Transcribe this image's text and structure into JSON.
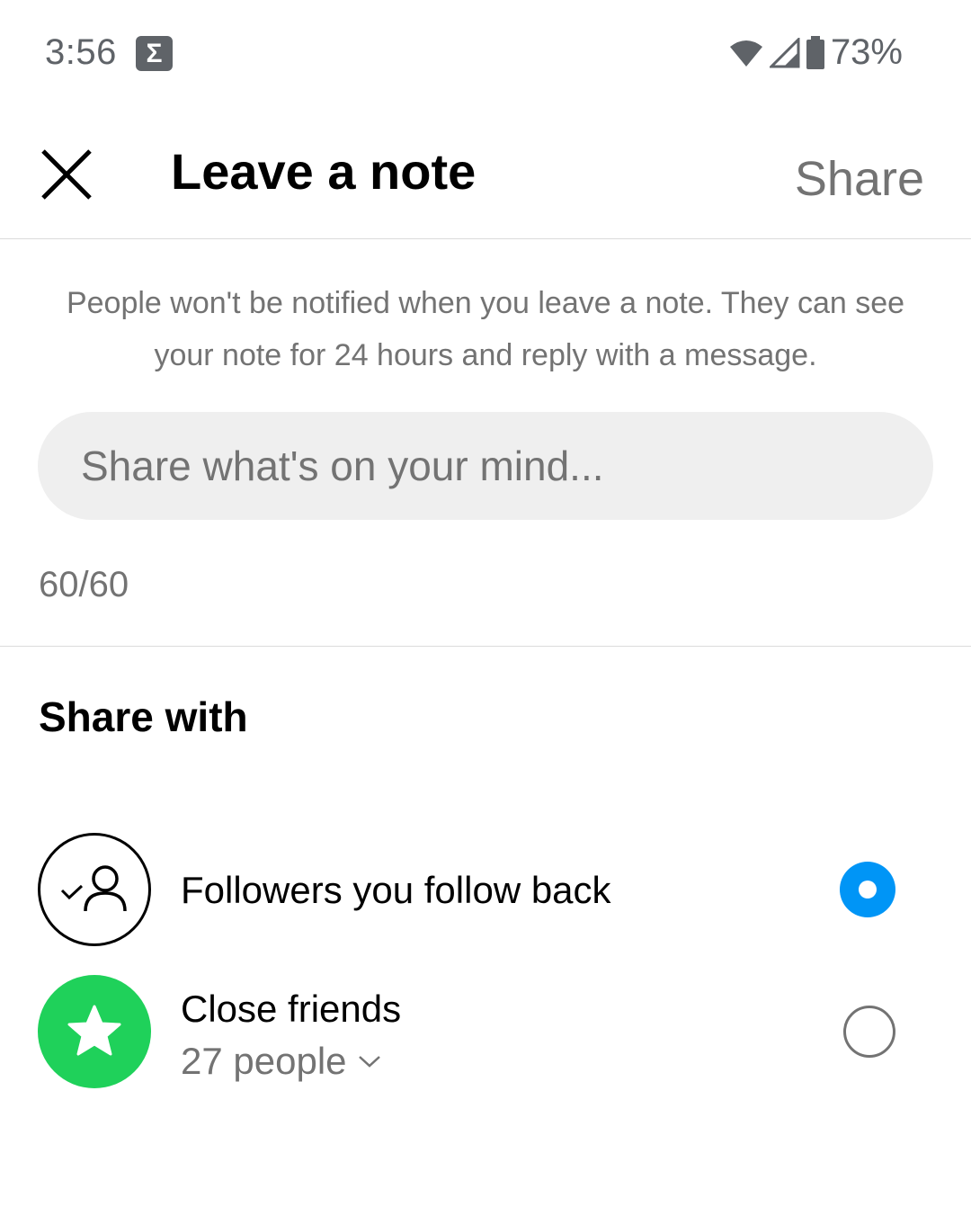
{
  "status_bar": {
    "time": "3:56",
    "notification_icon": "sigma-icon",
    "battery_percent": "73%",
    "icons": [
      "wifi-icon",
      "cell-signal-icon",
      "battery-icon"
    ]
  },
  "header": {
    "title": "Leave a note",
    "close_icon": "close-icon",
    "share_label": "Share"
  },
  "info_text": "People won't be notified when you leave a note. They can see your note for 24 hours and reply with a message.",
  "note_input": {
    "value": "",
    "placeholder": "Share what's on your mind..."
  },
  "char_count": "60/60",
  "share_with": {
    "heading": "Share with",
    "options": [
      {
        "label": "Followers you follow back",
        "icon": "follow-back-icon",
        "selected": true
      },
      {
        "label": "Close friends",
        "sublabel": "27 people",
        "icon": "star-icon",
        "selected": false
      }
    ]
  },
  "colors": {
    "accent": "#0095f6",
    "close_friends_green": "#1fd15a",
    "secondary_text": "#737373"
  }
}
